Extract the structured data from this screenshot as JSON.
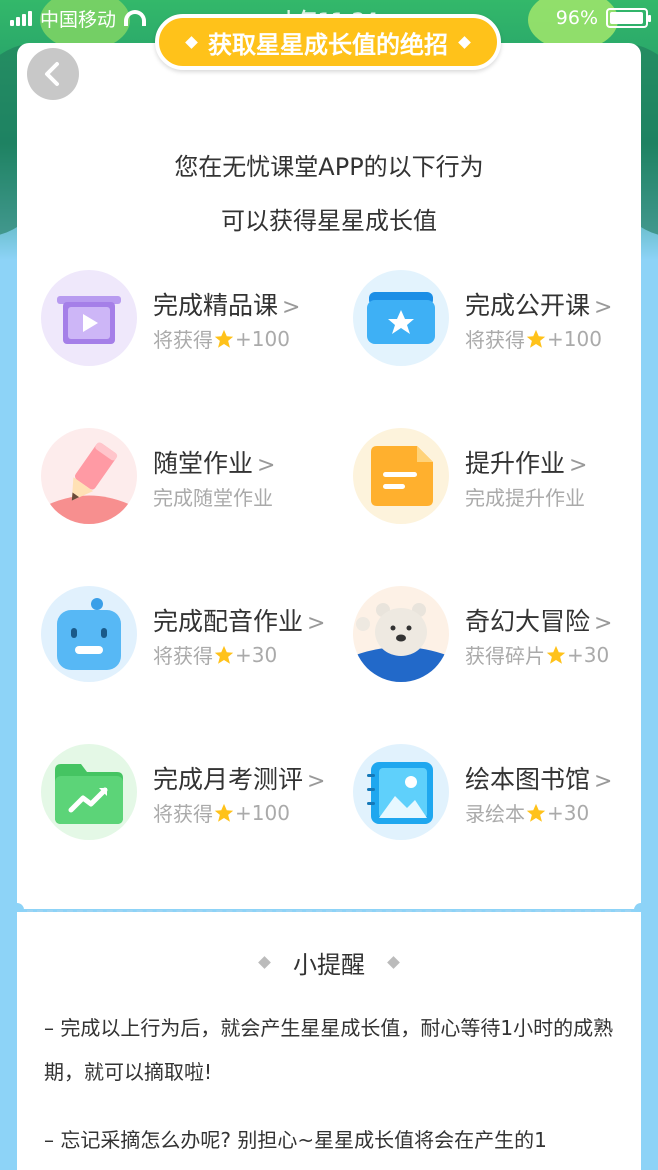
{
  "status_bar": {
    "carrier": "中国移动",
    "time": "上午11:24",
    "battery": "96%",
    "battery_level": 0.96
  },
  "header": {
    "title": "获取星星成长值的绝招"
  },
  "intro": {
    "line1": "您在无忧课堂APP的以下行为",
    "line2": "可以获得星星成长值"
  },
  "items": [
    {
      "title": "完成精品课",
      "sub_prefix": "将获得",
      "sub_suffix": "+100",
      "has_star": true,
      "icon": "video-play-icon"
    },
    {
      "title": "完成公开课",
      "sub_prefix": "将获得",
      "sub_suffix": "+100",
      "has_star": true,
      "icon": "star-box-icon"
    },
    {
      "title": "随堂作业",
      "sub_prefix": "完成随堂作业",
      "sub_suffix": "",
      "has_star": false,
      "icon": "pencil-icon"
    },
    {
      "title": "提升作业",
      "sub_prefix": "完成提升作业",
      "sub_suffix": "",
      "has_star": false,
      "icon": "note-icon"
    },
    {
      "title": "完成配音作业",
      "sub_prefix": "将获得",
      "sub_suffix": "+30",
      "has_star": true,
      "icon": "robot-icon"
    },
    {
      "title": "奇幻大冒险",
      "sub_prefix": "获得碎片",
      "sub_suffix": "+30",
      "has_star": true,
      "icon": "bear-icon"
    },
    {
      "title": "完成月考测评",
      "sub_prefix": "将获得",
      "sub_suffix": "+100",
      "has_star": true,
      "icon": "trend-folder-icon"
    },
    {
      "title": "绘本图书馆",
      "sub_prefix": "录绘本",
      "sub_suffix": "+30",
      "has_star": true,
      "icon": "picture-book-icon"
    }
  ],
  "tips": {
    "title": "小提醒",
    "paragraphs": [
      "– 完成以上行为后，就会产生星星成长值，耐心等待1小时的成熟期，就可以摘取啦!",
      "– 忘记采摘怎么办呢? 别担心~星星成长值将会在产生的1"
    ]
  },
  "colors": {
    "accent": "#ffc21a",
    "star": "#ffc21a",
    "background": "#8dd3f7"
  }
}
